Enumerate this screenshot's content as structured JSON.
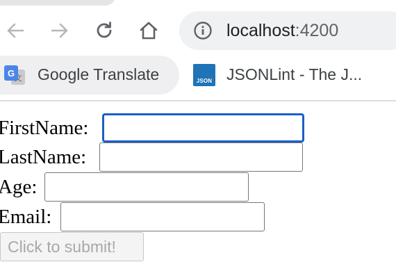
{
  "browser": {
    "address_bar": {
      "host": "localhost",
      "port": ":4200"
    },
    "bookmarks": [
      {
        "label": "Google Translate",
        "icon": "google-translate-icon"
      },
      {
        "label": "JSONLint - The J...",
        "icon": "jsonlint-icon",
        "icon_text": "JSON"
      }
    ]
  },
  "form": {
    "fields": [
      {
        "label": "FirstName:",
        "value": "",
        "focused": true
      },
      {
        "label": "LastName:",
        "value": ""
      },
      {
        "label": "Age:",
        "value": ""
      },
      {
        "label": "Email:",
        "value": ""
      }
    ],
    "submit_label": "Click to submit!",
    "submit_disabled": true
  },
  "colors": {
    "focus_ring": "#1a5fc9",
    "chrome_pill": "#eff1f3",
    "jsonlint_icon": "#1f73b7"
  }
}
